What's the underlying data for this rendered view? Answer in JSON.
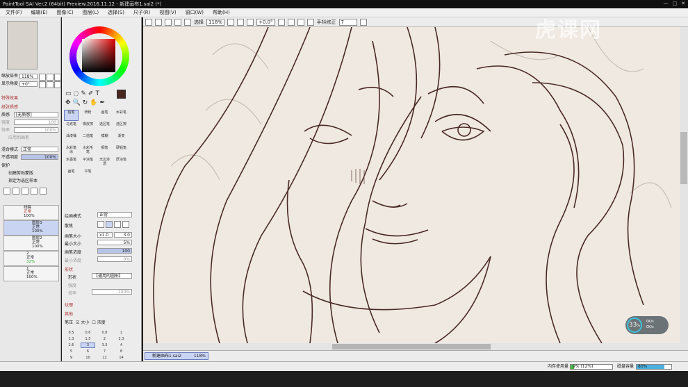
{
  "window": {
    "title": "PaintTool SAI Ver.2 (64bit) Preview.2016.11.12 - 新建画布1.sai2 (*)"
  },
  "watermark": "虎课网",
  "menu": [
    "文件(F)",
    "编辑(E)",
    "图像(C)",
    "图层(L)",
    "选择(S)",
    "尺子(R)",
    "视图(V)",
    "窗口(W)",
    "帮助(H)"
  ],
  "toolbar": {
    "select_label": "选择",
    "zoom": "118%",
    "angle": "+0.0°",
    "stabilizer_label": "手抖修正",
    "stabilizer": "7"
  },
  "nav": {
    "zoom_label": "缩放倍率",
    "zoom": "118%",
    "angle_label": "显示角度",
    "angle": "+0°"
  },
  "layer_props": {
    "effects": "特殊效果",
    "texture": "纸张质感",
    "texture_label": "质感",
    "texture_value": "[无质感]",
    "strength_label": "强度",
    "strength": "100",
    "scale_label": "倍率",
    "scale": "100%",
    "apply_canvas": "应用到画笔",
    "blend_label": "混合模式",
    "blend": "正常",
    "opacity_label": "不透明度",
    "opacity": "100%",
    "protect_label": "保护",
    "clip": "创建剪贴蒙版",
    "sel_source": "指定为选区样本"
  },
  "layers": [
    {
      "name": "线稿",
      "mode": "正常",
      "opacity": "100%"
    },
    {
      "name": "图层3",
      "mode": "正常",
      "opacity": "100%"
    },
    {
      "name": "图层2",
      "mode": "正常",
      "opacity": "100%"
    },
    {
      "name": "2",
      "mode": "正常",
      "opacity": "32%"
    },
    {
      "name": "1",
      "mode": "正常",
      "opacity": "100%"
    }
  ],
  "tools": [
    "铅笔",
    "喷枪",
    "画笔",
    "水彩笔",
    "马克笔",
    "橡皮擦",
    "选区笔",
    "选区擦",
    "油漆桶",
    "二值笔",
    "模糊",
    "渐变",
    "水彩笔涂",
    "水彩毛笔",
    "钢笔",
    "硬铅笔",
    "水墨笔",
    "平涂笔",
    "无边渗透",
    "厚涂笔",
    "画笔",
    "平笔",
    "",
    ""
  ],
  "brush": {
    "blend_label": "绘画模式",
    "blend": "正常",
    "edge_label": "散焦",
    "size_label": "画笔大小",
    "size_mul": "x1.0",
    "size": "3.0",
    "min_label": "最小大小",
    "min": "5%",
    "density_label": "画笔浓度",
    "density": "100",
    "min_density_label": "最小浓度",
    "min_density": "0%",
    "shape_section": "形状",
    "shape_label": "形状",
    "shape": "【通用的圆形】",
    "shape_strength_label": "强度",
    "shape_scale_label": "倍率",
    "shape_scale": "100%",
    "texture_section": "纹理",
    "other_section": "其他",
    "pressure_label": "笔压",
    "pressure_size": "大小",
    "pressure_density": "浓度"
  },
  "sizes": [
    "0.5",
    "0.6",
    "0.8",
    "1",
    "1.3",
    "1.5",
    "2",
    "2.3",
    "2.6",
    "3",
    "3.3",
    "4",
    "5",
    "6",
    "7",
    "8",
    "9",
    "10",
    "12",
    "14"
  ],
  "document": {
    "tab_name": "新建画布1.sai2",
    "tab_zoom": "118%"
  },
  "status": {
    "mem_label": "内存使用量",
    "mem": "9% (12%)",
    "disk_label": "磁盘容量",
    "disk": "80%"
  },
  "perf": {
    "value": "33",
    "unit": "%",
    "up": "0K/s",
    "down": "0K/s"
  }
}
